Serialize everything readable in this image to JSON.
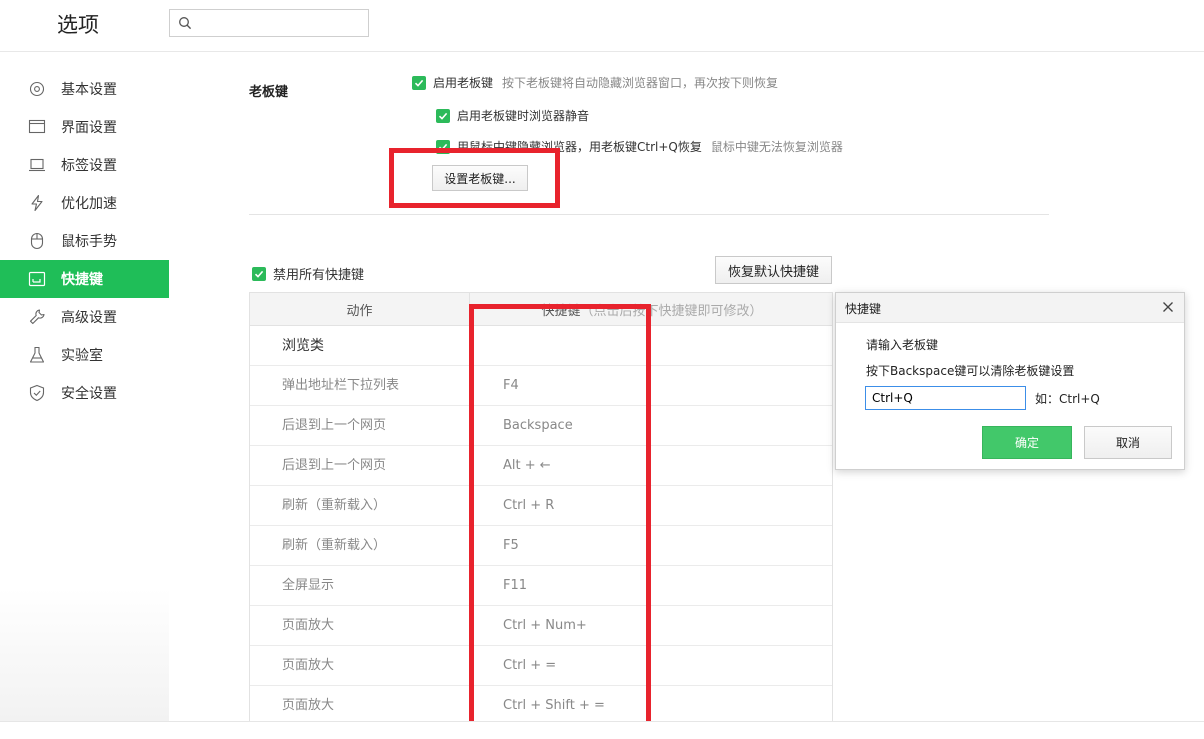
{
  "header": {
    "title": "选项",
    "search": {
      "value": "",
      "placeholder": ""
    }
  },
  "sidebar": {
    "items": [
      {
        "label": "基本设置",
        "icon": "gear-icon",
        "active": false
      },
      {
        "label": "界面设置",
        "icon": "window-icon",
        "active": false
      },
      {
        "label": "标签设置",
        "icon": "laptop-icon",
        "active": false
      },
      {
        "label": "优化加速",
        "icon": "lightning-icon",
        "active": false
      },
      {
        "label": "鼠标手势",
        "icon": "mouse-icon",
        "active": false
      },
      {
        "label": "快捷键",
        "icon": "keyboard-icon",
        "active": true
      },
      {
        "label": "高级设置",
        "icon": "wrench-icon",
        "active": false
      },
      {
        "label": "实验室",
        "icon": "flask-icon",
        "active": false
      },
      {
        "label": "安全设置",
        "icon": "shield-icon",
        "active": false
      }
    ],
    "active_color": "#1fbe58"
  },
  "boss_key": {
    "section_label": "老板键",
    "enable_label": "启用老板键",
    "enable_hint": "按下老板键将自动隐藏浏览器窗口，再次按下则恢复",
    "mute_label": "启用老板键时浏览器静音",
    "middle_label": "用鼠标中键隐藏浏览器，用老板键Ctrl+Q恢复",
    "middle_hint": "鼠标中键无法恢复浏览器",
    "set_button": "设置老板键..."
  },
  "shortcuts": {
    "disable_all_label": "禁用所有快捷键",
    "restore_button": "恢复默认快捷键",
    "col_action": "动作",
    "col_key": "快捷键",
    "col_key_note": "（点击后按下快捷键即可修改）",
    "rows": [
      {
        "action": "浏览类",
        "key": ""
      },
      {
        "action": "弹出地址栏下拉列表",
        "key": "F4"
      },
      {
        "action": "后退到上一个网页",
        "key": "Backspace"
      },
      {
        "action": "后退到上一个网页",
        "key": "Alt + ←"
      },
      {
        "action": "刷新（重新载入）",
        "key": "Ctrl + R"
      },
      {
        "action": "刷新（重新载入）",
        "key": "F5"
      },
      {
        "action": "全屏显示",
        "key": "F11"
      },
      {
        "action": "页面放大",
        "key": "Ctrl + Num+"
      },
      {
        "action": "页面放大",
        "key": "Ctrl + ="
      },
      {
        "action": "页面放大",
        "key": "Ctrl + Shift + ="
      }
    ]
  },
  "dialog": {
    "title": "快捷键",
    "prompt": "请输入老板键",
    "hint": "按下Backspace键可以清除老板键设置",
    "input_value": "Ctrl+Q",
    "example": "如：Ctrl+Q",
    "ok": "确定",
    "cancel": "取消"
  },
  "colors": {
    "accent_green": "#1fbe58",
    "checkbox_green": "#2cba5a",
    "highlight_red": "#e8232d"
  }
}
